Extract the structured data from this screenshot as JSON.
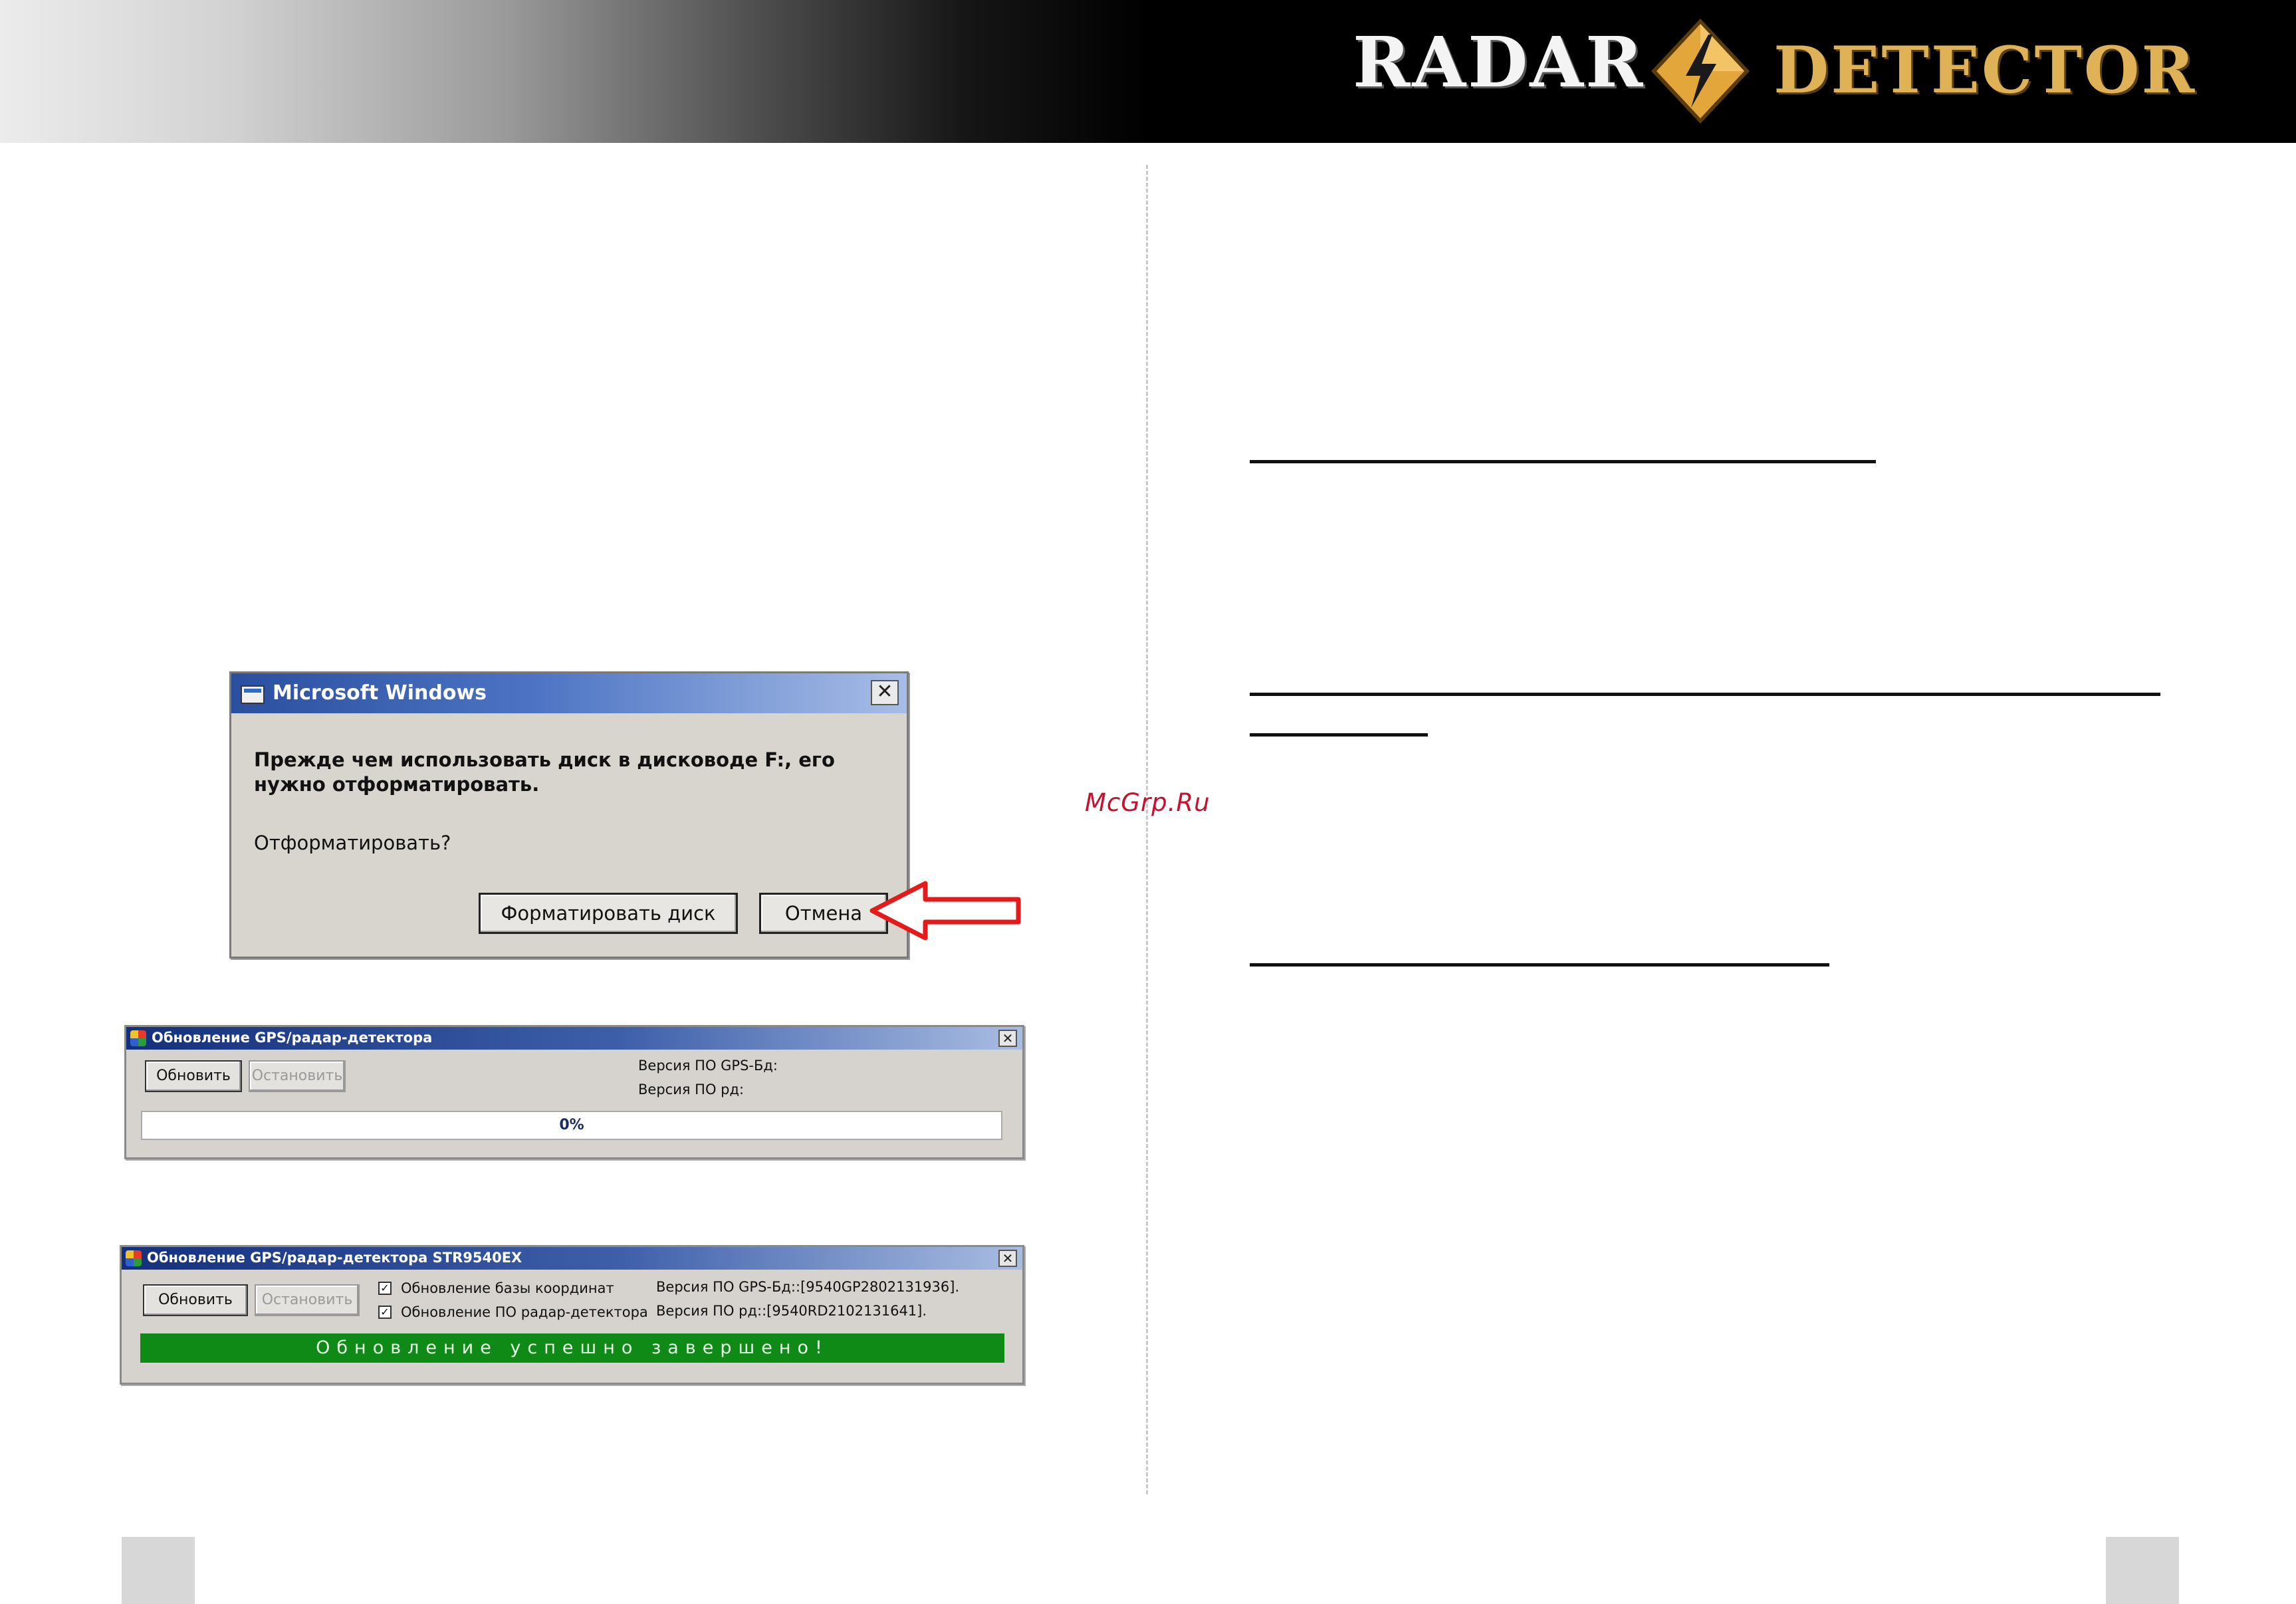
{
  "banner": {
    "logo_left": "RADAR",
    "logo_right": "DETECTOR",
    "icon": "lightning-diamond-icon",
    "colors": {
      "logo_left": "#f4f4f4",
      "logo_right": "#e0b257",
      "diamond": "#e3a63a"
    }
  },
  "watermark": "McGrp.Ru",
  "format_dialog": {
    "title": "Microsoft Windows",
    "message": "Прежде чем использовать диск в дисководе F:, его нужно отформатировать.",
    "question": "Отформатировать?",
    "format_button": "Форматировать диск",
    "cancel_button": "Отмена",
    "close_icon": "close-icon",
    "highlight_arrow_color": "#e31b1b"
  },
  "updater_idle": {
    "title": "Обновление GPS/радар-детектора",
    "update_button": "Обновить",
    "stop_button": "Остановить",
    "gps_db_version_label": "Версия ПО GPS-Бд:",
    "rd_version_label": "Версия ПО рд:",
    "progress_percent": 0,
    "progress_text": "0%"
  },
  "updater_done": {
    "title": "Обновление GPS/радар-детектора STR9540EX",
    "update_button": "Обновить",
    "stop_button": "Остановить",
    "checkbox_coords_label": "Обновление базы координат",
    "checkbox_coords_checked": true,
    "checkbox_fw_label": "Обновление ПО радар-детектора",
    "checkbox_fw_checked": true,
    "gps_db_version": "Версия ПО GPS-Бд::[9540GP2802131936].",
    "rd_version": "Версия ПО рд::[9540RD2102131641].",
    "status_text": "Обновление успешно завершено!",
    "status_color": "#0f8a16"
  }
}
